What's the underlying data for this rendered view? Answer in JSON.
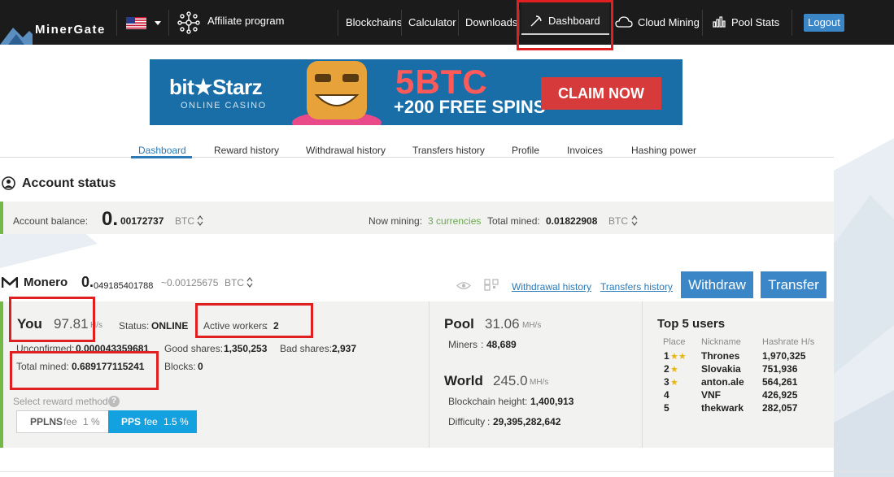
{
  "brand": {
    "logo_text": "MinerGate"
  },
  "nav": {
    "affiliate": "Affiliate program",
    "links": [
      "Blockchains",
      "Calculator",
      "Downloads"
    ],
    "dashboard": "Dashboard",
    "cloud_mining": "Cloud Mining",
    "pool_stats": "Pool Stats",
    "logout": "Logout"
  },
  "banner": {
    "brand": "bit★Starz",
    "brand_sub": "ONLINE CASINO",
    "big": "5BTC",
    "spins": "+200 FREE SPINS",
    "claim": "CLAIM NOW"
  },
  "subtabs": [
    "Dashboard",
    "Reward history",
    "Withdrawal history",
    "Transfers history",
    "Profile",
    "Invoices",
    "Hashing power"
  ],
  "account": {
    "title": "Account status",
    "balance_label": "Account balance:",
    "balance_int": "0.",
    "balance_dec": "00172737",
    "currency": "BTC",
    "now_mining_label": "Now mining:",
    "now_mining_value": "3 currencies",
    "total_mined_label": "Total mined:",
    "total_mined_value": "0.01822908",
    "total_currency": "BTC"
  },
  "coin": {
    "name": "Monero",
    "balance_int": "0.",
    "balance_dec": "049185401788",
    "approx": "~0.00125675",
    "currency": "BTC",
    "withdrawal_history": "Withdrawal history",
    "transfers_history": "Transfers history",
    "withdraw": "Withdraw",
    "transfer": "Transfer"
  },
  "you": {
    "label": "You",
    "hashrate": "97.81",
    "unit": "H/s",
    "status_label": "Status:",
    "status_value": "ONLINE",
    "workers_label": "Active workers",
    "workers_value": "2",
    "unconfirmed_label": "Unconfirmed:",
    "unconfirmed_value": "0.000043359681",
    "good_label": "Good shares:",
    "good_value": "1,350,253",
    "bad_label": "Bad shares:",
    "bad_value": "2,937",
    "total_label": "Total mined:",
    "total_value": "0.689177115241",
    "blocks_label": "Blocks:",
    "blocks_value": "0",
    "reward_label": "Select reward method",
    "pplns_name": "PPLNS",
    "pplns_fee_label": "fee",
    "pplns_fee": "1 %",
    "pps_name": "PPS",
    "pps_fee_label": "fee",
    "pps_fee": "1.5 %"
  },
  "pool": {
    "label": "Pool",
    "hashrate": "31.06",
    "unit": "MH/s",
    "miners_label": "Miners",
    "miners_value": "48,689"
  },
  "world": {
    "label": "World",
    "hashrate": "245.0",
    "unit": "MH/s",
    "height_label": "Blockchain height",
    "height_value": "1,400,913",
    "difficulty_label": "Difficulty",
    "difficulty_value": "29,395,282,642"
  },
  "top_users": {
    "title": "Top 5 users",
    "headers": [
      "Place",
      "Nickname",
      "Hashrate H/s"
    ],
    "rows": [
      {
        "place": "1",
        "name": "Thrones",
        "rate": "1,970,325"
      },
      {
        "place": "2",
        "name": "Slovakia",
        "rate": "751,936"
      },
      {
        "place": "3",
        "name": "anton.ale",
        "rate": "564,261"
      },
      {
        "place": "4",
        "name": "VNF",
        "rate": "426,925"
      },
      {
        "place": "5",
        "name": "thekwark",
        "rate": "282,057"
      }
    ]
  }
}
